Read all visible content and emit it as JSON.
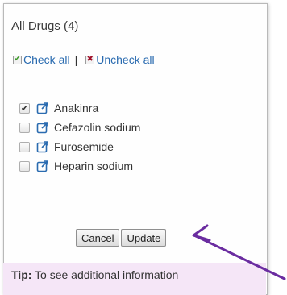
{
  "panel": {
    "title": "All Drugs (4)",
    "check_all_label": "Check all",
    "separator": "|",
    "uncheck_all_label": "Uncheck all"
  },
  "drugs": [
    {
      "name": "Anakinra",
      "checked": true
    },
    {
      "name": "Cefazolin sodium",
      "checked": false
    },
    {
      "name": "Furosemide",
      "checked": false
    },
    {
      "name": "Heparin sodium",
      "checked": false
    }
  ],
  "buttons": {
    "cancel_label": "Cancel",
    "update_label": "Update"
  },
  "tip": {
    "label": "Tip:",
    "text": " To see additional information"
  },
  "colors": {
    "link": "#2a6bb0",
    "arrow": "#6a2ca0",
    "tip_background": "#f5e6f7"
  },
  "icons": {
    "check_all": "green-check-icon",
    "uncheck_all": "red-x-icon",
    "drug_link": "external-link-icon",
    "annotation": "arrow-icon"
  }
}
